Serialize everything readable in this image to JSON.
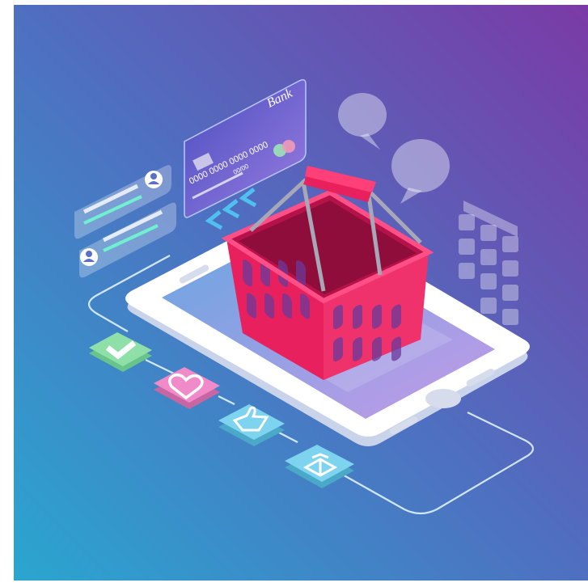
{
  "card": {
    "bank": "Bank",
    "number": "0000 0000 0000 0000",
    "expiry": "00/00"
  },
  "colors": {
    "bg_top_right": "#7b3aa6",
    "bg_bottom_left": "#2aa6d0",
    "basket": "#e8215e",
    "basket_dark": "#b5124a",
    "check_tile": "#8ee0a8",
    "heart_tile": "#f08ac8",
    "like_tile": "#7ed3ef",
    "gift_tile": "#7ed3ef"
  },
  "icons": [
    "check-icon",
    "heart-icon",
    "thumbs-up-icon",
    "gift-icon",
    "chat-bubble-icon",
    "user-icon",
    "keypad-icon",
    "chevron-left-icon"
  ]
}
